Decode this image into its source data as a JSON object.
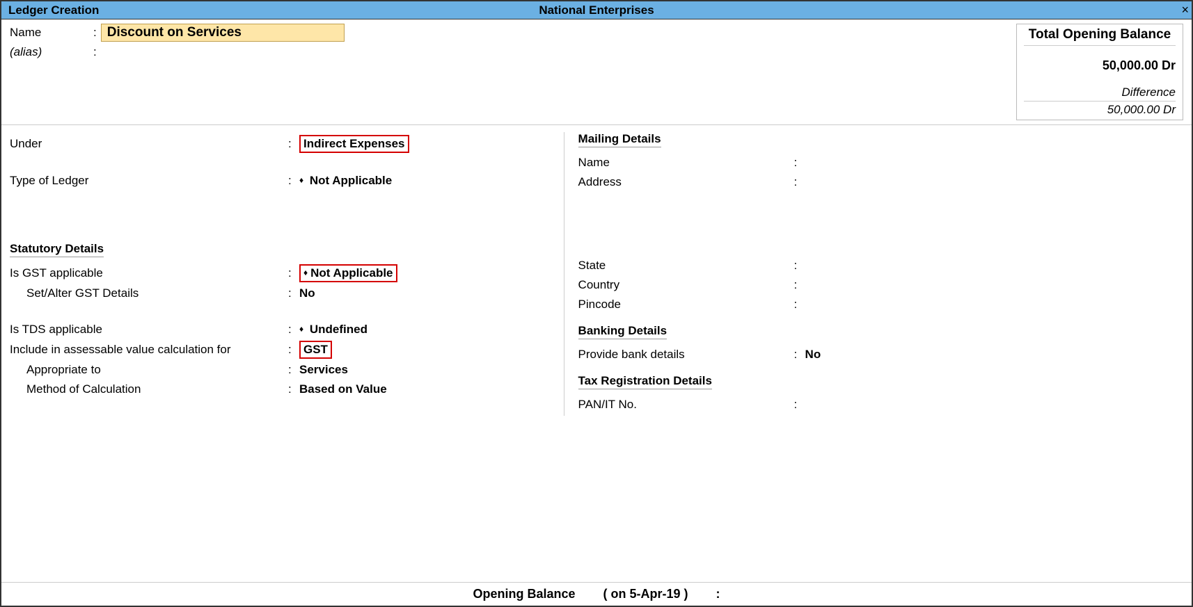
{
  "titlebar": {
    "left": "Ledger Creation",
    "center": "National Enterprises",
    "close": "×"
  },
  "name_row": {
    "label": "Name",
    "value": "Discount on Services"
  },
  "alias_row": {
    "label": "(alias)"
  },
  "balance": {
    "header": "Total Opening Balance",
    "amount": "50,000.00 Dr",
    "diff_label": "Difference",
    "diff_amount": "50,000.00 Dr"
  },
  "left": {
    "under_label": "Under",
    "under_value": "Indirect Expenses",
    "type_label": "Type of Ledger",
    "type_value": "Not Applicable",
    "stat_header": "Statutory Details",
    "gst_app_label": "Is GST applicable",
    "gst_app_value": "Not Applicable",
    "gst_alter_label": "Set/Alter GST Details",
    "gst_alter_value": "No",
    "tds_label": "Is TDS applicable",
    "tds_value": "Undefined",
    "include_label": "Include in assessable value calculation for",
    "include_value": "GST",
    "appropriate_label": "Appropriate to",
    "appropriate_value": "Services",
    "method_label": "Method of Calculation",
    "method_value": "Based on Value"
  },
  "right": {
    "mail_header": "Mailing Details",
    "name_label": "Name",
    "address_label": "Address",
    "state_label": "State",
    "country_label": "Country",
    "pincode_label": "Pincode",
    "bank_header": "Banking Details",
    "bank_label": "Provide bank details",
    "bank_value": "No",
    "tax_header": "Tax Registration Details",
    "pan_label": "PAN/IT No."
  },
  "bottom": {
    "opening_label": "Opening Balance",
    "date_label": "( on 5-Apr-19 )",
    "sep": ":"
  }
}
